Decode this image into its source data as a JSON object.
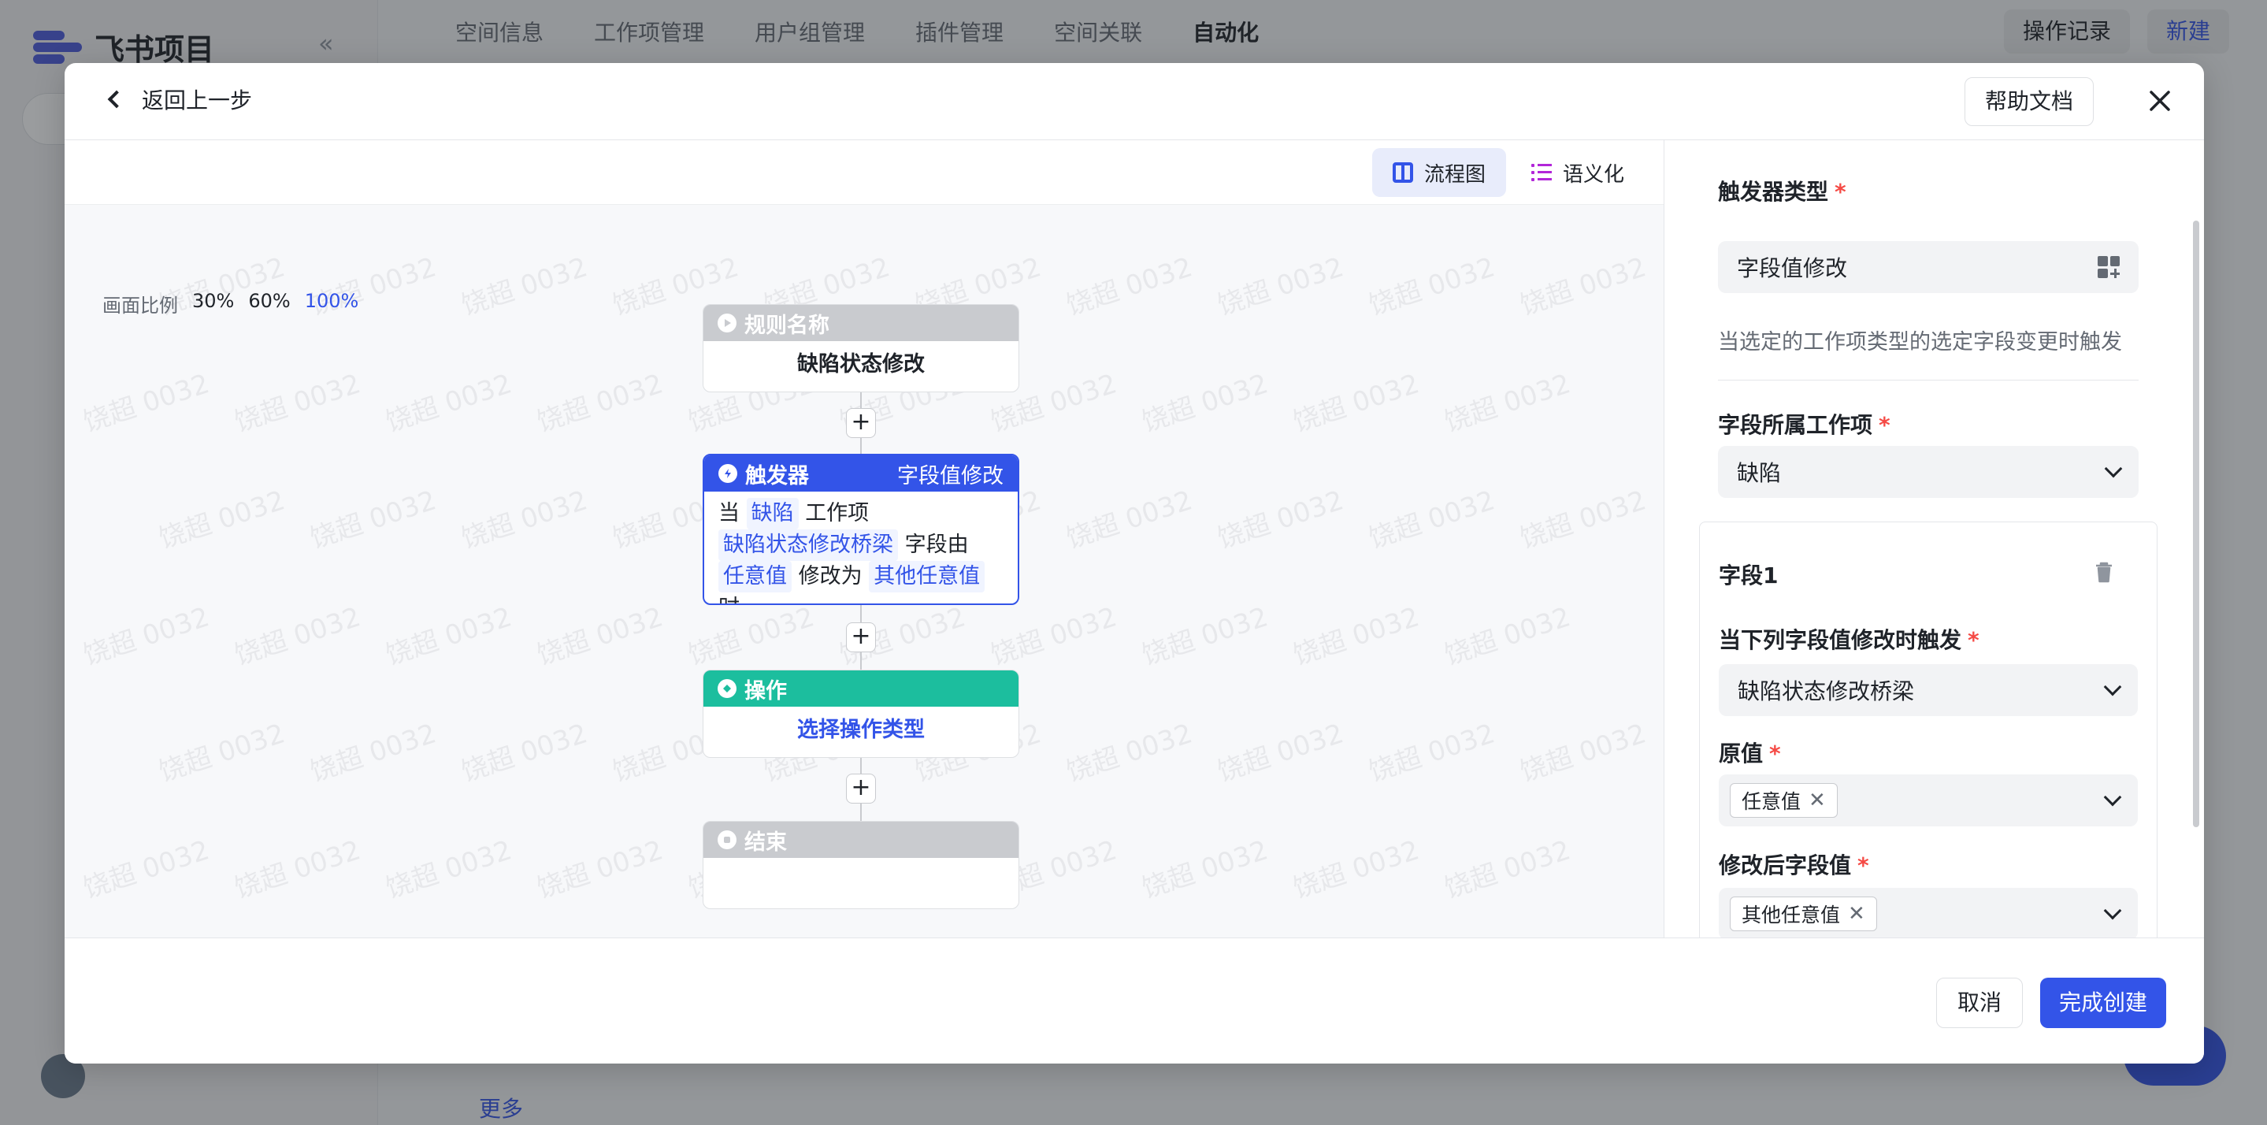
{
  "background": {
    "logo_text": "飞书项目",
    "collapse_icon": "«",
    "top_nav": [
      "空间信息",
      "工作项管理",
      "用户组管理",
      "插件管理",
      "空间关联",
      "自动化"
    ],
    "active_nav": "自动化",
    "op_record_label": "操作记录",
    "new_label": "新建",
    "more_label": "更多"
  },
  "modal": {
    "back_label": "返回上一步",
    "help_label": "帮助文档",
    "view_tabs": [
      {
        "label": "流程图",
        "active": true
      },
      {
        "label": "语义化",
        "active": false
      }
    ],
    "zoom": {
      "label": "画面比例",
      "options": [
        "30%",
        "60%",
        "100%"
      ],
      "active": "100%"
    },
    "watermark": "饶超 0032",
    "flow": {
      "name_node": {
        "title": "规则名称",
        "value": "缺陷状态修改"
      },
      "trigger_node": {
        "title": "触发器",
        "type": "字段值修改",
        "text": {
          "p1": "当",
          "c1": "缺陷",
          "p2": "工作项",
          "c2": "缺陷状态修改桥梁",
          "p3": "字段由",
          "c3": "任意值",
          "p4": "修改为",
          "c4": "其他任意值",
          "p5": "时"
        }
      },
      "action_node": {
        "title": "操作",
        "value": "选择操作类型"
      },
      "end_node": {
        "title": "结束"
      },
      "plus": "+"
    },
    "panel": {
      "trigger_type_label": "触发器类型",
      "trigger_type_value": "字段值修改",
      "trigger_desc": "当选定的工作项类型的选定字段变更时触发",
      "workitem_label": "字段所属工作项",
      "workitem_value": "缺陷",
      "field_title": "字段1",
      "field_trigger_label": "当下列字段值修改时触发",
      "field_trigger_value": "缺陷状态修改桥梁",
      "original_label": "原值",
      "original_tag": "任意值",
      "new_label": "修改后字段值",
      "new_tag": "其他任意值",
      "required_mark": "*"
    },
    "footer": {
      "cancel_label": "取消",
      "confirm_label": "完成创建"
    }
  },
  "colors": {
    "accent": "#3354e8",
    "trigger": "#3354e8",
    "action": "#1cbe9e",
    "neutral": "#c9cbcf",
    "required": "#f54a45"
  }
}
